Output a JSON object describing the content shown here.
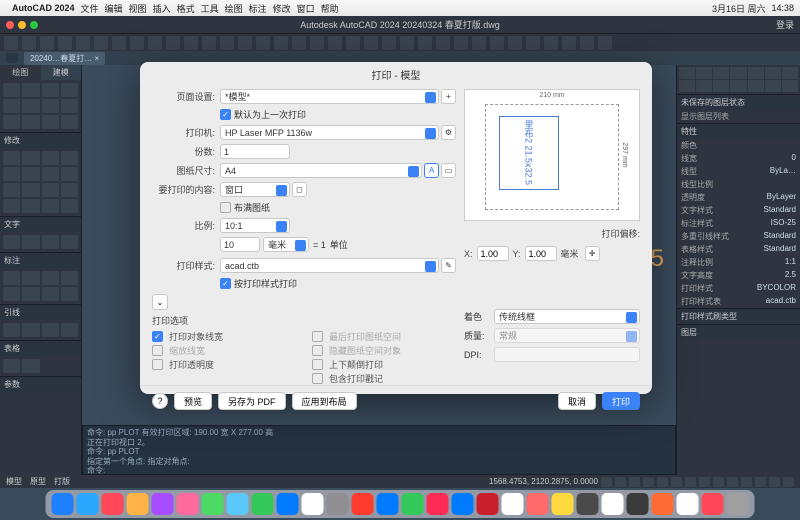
{
  "menubar": {
    "app": "AutoCAD 2024",
    "items": [
      "文件",
      "编辑",
      "视图",
      "插入",
      "格式",
      "工具",
      "绘图",
      "标注",
      "修改",
      "窗口",
      "帮助"
    ],
    "date": "3月16日 周六",
    "time": "14:38"
  },
  "titlebar": {
    "title": "Autodesk AutoCAD 2024   20240324 春夏打版.dwg",
    "login": "登录"
  },
  "doctab": "20240…春夏打… ×",
  "leftpanel": {
    "tab1": "绘图",
    "tab2": "建模",
    "sections": [
      "修改",
      "文字",
      "标注",
      "引线",
      "表格",
      "参数"
    ]
  },
  "rightpanel": {
    "unsaved": "未保存的图层状态",
    "showlist": "显示图层列表",
    "props_title": "特性",
    "rows": [
      {
        "k": "颜色",
        "v": ""
      },
      {
        "k": "线宽",
        "v": "0"
      },
      {
        "k": "线型",
        "v": "ByLa…"
      },
      {
        "k": "线型比例",
        "v": ""
      },
      {
        "k": "透明度",
        "v": "ByLayer"
      },
      {
        "k": "文字样式",
        "v": "Standard"
      },
      {
        "k": "标注样式",
        "v": "ISO-25"
      },
      {
        "k": "多重引线样式",
        "v": "Standard"
      },
      {
        "k": "表格样式",
        "v": "Standard"
      },
      {
        "k": "注释比例",
        "v": "1:1"
      },
      {
        "k": "文字高度",
        "v": "2.5"
      },
      {
        "k": "打印样式",
        "v": "BYCOLOR"
      },
      {
        "k": "打印样式表",
        "v": "acad.ctb"
      }
    ],
    "section2": "打印样式刷类型",
    "section3": "图层"
  },
  "canvas": {
    "bigtext": ".5"
  },
  "cmd": {
    "l1": "命令: pp PLOT 有效打印区域: 190.00 宽 X 277.00 高",
    "l2": "正在打印视口 2。",
    "l3": "命令: pp PLOT",
    "l4": "指定第一个角点: 指定对角点:",
    "l5": "命令:",
    "prompt": "PLOT 指定第一个角点: 指定对角点:"
  },
  "status": {
    "tabs": [
      "模型",
      "原型",
      "打版"
    ],
    "coords": "1568.4753, 2120.2875, 0.0000"
  },
  "dialog": {
    "title": "打印 - 模型",
    "page_setup_lbl": "页面设置:",
    "page_setup_val": "*模型*",
    "default_last": "默认为上一次打印",
    "printer_lbl": "打印机:",
    "printer_val": "HP Laser MFP 1136w",
    "copies_lbl": "份数:",
    "copies_val": "1",
    "paper_lbl": "图纸尺寸:",
    "paper_val": "A4",
    "what_lbl": "要打印的内容:",
    "what_val": "窗口",
    "fit": "布满图纸",
    "scale_lbl": "比例:",
    "scale_val": "10:1",
    "scale_left": "10",
    "scale_unit_l": "毫米",
    "scale_eq": "= 1",
    "scale_unit_r": "单位",
    "style_lbl": "打印样式:",
    "style_val": "acad.ctb",
    "by_style": "按打印样式打印",
    "preview": {
      "dim_top": "210 mm",
      "dim_right": "297 mm",
      "inner1": "里布2",
      "inner2": "21.5x32.5"
    },
    "offset_lbl": "打印偏移:",
    "offset_x_lbl": "X:",
    "offset_x": "1.00",
    "offset_y_lbl": "Y:",
    "offset_y": "1.00",
    "offset_unit": "毫米",
    "options_title": "打印选项",
    "opts": {
      "a": "打印对象线宽",
      "b": "缩放线宽",
      "c": "打印透明度",
      "d": "最后打印图纸空间",
      "e": "隐藏图纸空间对象",
      "f": "上下颠倒打印",
      "g": "包含打印戳记"
    },
    "shade_lbl": "着色",
    "shade_val": "传统线框",
    "quality_lbl": "质量:",
    "quality_val": "常规",
    "dpi_lbl": "DPI:",
    "btn_preview": "预览",
    "btn_pdf": "另存为 PDF",
    "btn_apply": "应用到布局",
    "btn_cancel": "取消",
    "btn_print": "打印"
  }
}
